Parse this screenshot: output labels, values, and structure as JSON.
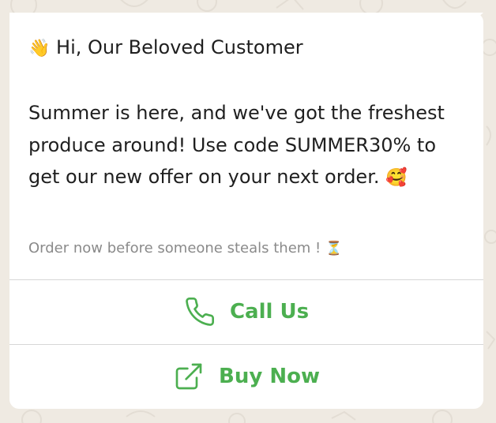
{
  "message": {
    "greeting_emoji": "👋",
    "greeting": "Hi, Our Beloved Customer",
    "body": "Summer is here, and we've got the freshest produce around! Use code SUMMER30% to get our new offer on your next order.",
    "body_emoji": "🥰",
    "footer": "Order now before someone steals them !",
    "footer_emoji": "⏳"
  },
  "actions": [
    {
      "label": "Call Us",
      "icon": "phone-icon"
    },
    {
      "label": "Buy Now",
      "icon": "external-link-icon"
    }
  ],
  "colors": {
    "accent": "#4caf50",
    "bubble": "#ffffff",
    "background": "#efeae2",
    "text": "#1f1f1f",
    "footer_text": "#8a8a8a"
  }
}
